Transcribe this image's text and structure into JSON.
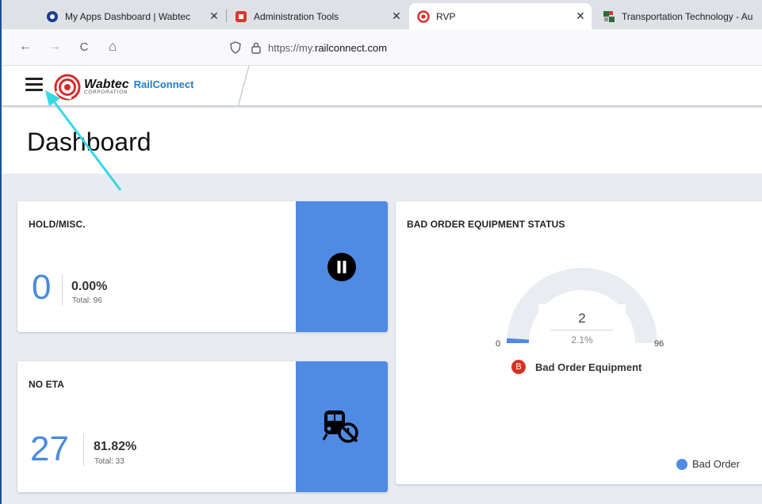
{
  "browser": {
    "tabs": [
      {
        "title": "My Apps Dashboard | Wabtec",
        "close": "✕"
      },
      {
        "title": "Administration Tools",
        "close": "✕"
      },
      {
        "title": "RVP",
        "close": "✕"
      },
      {
        "title": "Transportation Technology - Au",
        "close": "✕"
      }
    ],
    "active_tab_index": 2,
    "url_prefix": "https://my.",
    "url_domain": "railconnect.com",
    "back_icon": "←",
    "forward_icon": "→",
    "reload_icon": "C",
    "home_icon": "⌂"
  },
  "app": {
    "logo_brand": "Wabtec",
    "logo_sub": "CORPORATION",
    "logo_product": "RailConnect"
  },
  "page": {
    "title": "Dashboard"
  },
  "cards": {
    "hold": {
      "title": "HOLD/MISC.",
      "value": "0",
      "percent": "0.00%",
      "total": "Total: 96"
    },
    "no_eta": {
      "title": "NO ETA",
      "value": "27",
      "percent": "81.82%",
      "total": "Total: 33"
    }
  },
  "bad_order": {
    "title": "BAD ORDER EQUIPMENT STATUS",
    "gauge_min": "0",
    "gauge_max": "96",
    "gauge_value": "2",
    "gauge_percent": "2.1%",
    "gauge_fraction": 0.021,
    "badge": "B",
    "label": "Bad Order Equipment",
    "legend": "Bad Order"
  },
  "colors": {
    "accent": "#4f8be4",
    "big_number": "#4a8ae0",
    "badge_red": "#d93025",
    "annotation_arrow": "#35d8e6"
  }
}
